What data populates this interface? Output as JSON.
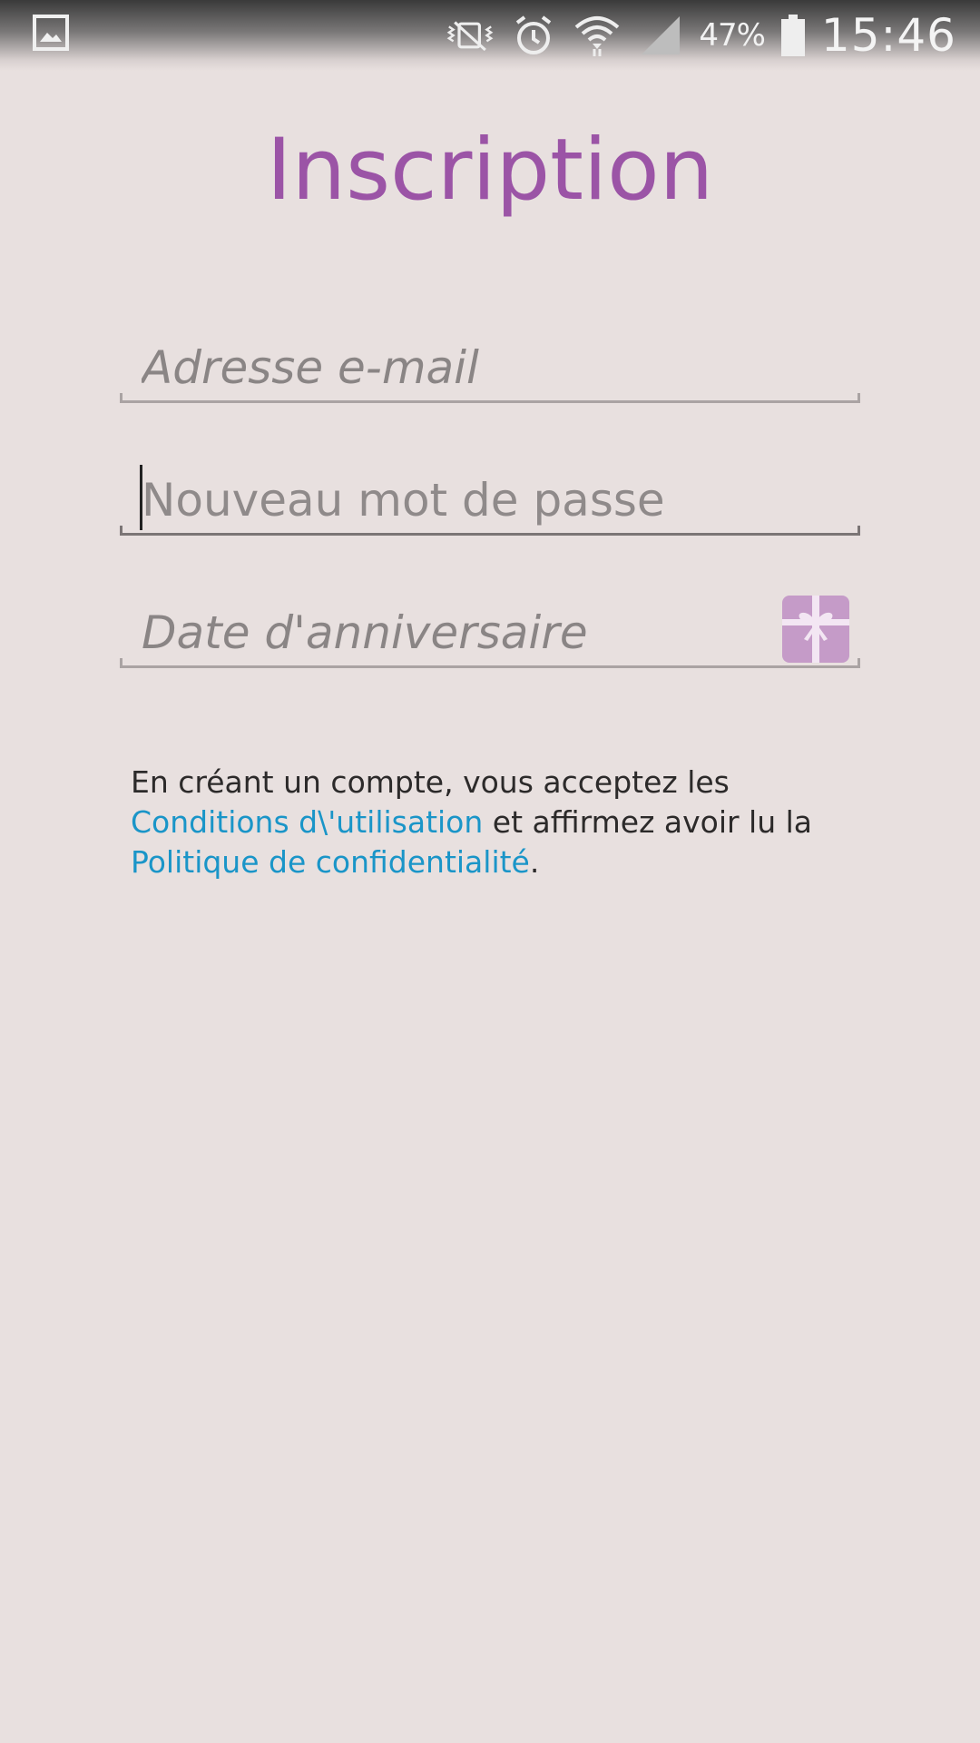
{
  "status_bar": {
    "left_icon": "gallery-notification-icon",
    "icons": [
      "vibrate-mute-icon",
      "alarm-icon",
      "wifi-icon",
      "signal-icon",
      "battery-icon"
    ],
    "battery_percent": "47%",
    "time": "15:46"
  },
  "page": {
    "title": "Inscription",
    "title_color": "#9b54a6"
  },
  "form": {
    "email": {
      "placeholder": "Adresse e-mail",
      "value": ""
    },
    "password": {
      "placeholder": "Nouveau mot de passe",
      "value": ""
    },
    "birthday": {
      "placeholder": "Date d'anniversaire",
      "value": "",
      "icon": "gift-icon"
    }
  },
  "legal": {
    "prefix": "En créant un compte, vous acceptez les ",
    "terms_link": "Conditions d\\'utilisation",
    "middle": " et affirmez avoir lu la ",
    "privacy_link": "Politique de confidentialité",
    "suffix": ".",
    "link_color": "#1a95c8"
  }
}
